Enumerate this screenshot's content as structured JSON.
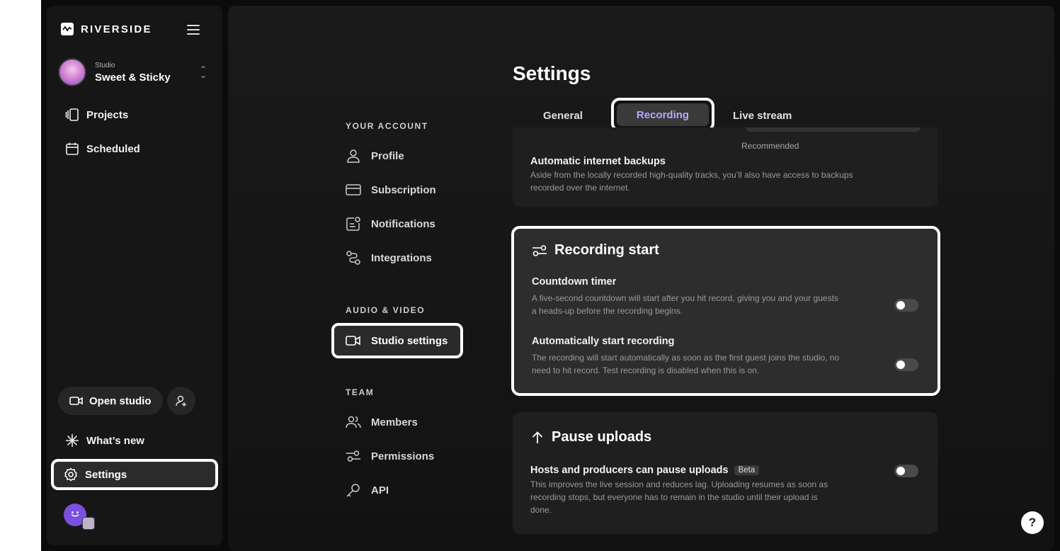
{
  "brand": {
    "name": "RIVERSIDE"
  },
  "studio": {
    "small_label": "Studio",
    "name": "Sweet & Sticky"
  },
  "sidebar": {
    "projects_label": "Projects",
    "scheduled_label": "Scheduled",
    "open_studio_label": "Open studio",
    "whats_new_label": "What’s new",
    "settings_label": "Settings"
  },
  "settings": {
    "title": "Settings",
    "sections": {
      "your_account": "YOUR ACCOUNT",
      "audio_video": "AUDIO & VIDEO",
      "team": "TEAM"
    },
    "account_items": [
      "Profile",
      "Subscription",
      "Notifications",
      "Integrations"
    ],
    "audio_video_items": [
      "Studio settings"
    ],
    "team_items": [
      "Members",
      "Permissions",
      "API"
    ]
  },
  "tabs": {
    "general": "General",
    "recording": "Recording",
    "live_stream": "Live stream"
  },
  "backups_card": {
    "recommended": "Recommended",
    "title": "Automatic internet backups",
    "desc_line1": "Aside from the locally recorded high-quality tracks, you’ll also have access to backups",
    "desc_line2": "recorded over the internet."
  },
  "recording_start": {
    "heading": "Recording start",
    "countdown_title": "Countdown timer",
    "countdown_desc1": "A five-second countdown will start after you hit record, giving you and your guests",
    "countdown_desc2": "a heads-up before the recording begins.",
    "countdown_enabled": false,
    "auto_title": "Automatically start recording",
    "auto_desc1": "The recording will start automatically as soon as the first guest joins the studio, no",
    "auto_desc2": "need to hit record. Test recording is disabled when this is on.",
    "auto_enabled": false
  },
  "pause_uploads": {
    "heading": "Pause uploads",
    "row_title": "Hosts and producers can pause uploads",
    "badge": "Beta",
    "desc1": "This improves the live session and reduces lag. Uploading resumes as soon as",
    "desc2": "recording stops, but everyone has to remain in the studio until their upload is",
    "desc3": "done.",
    "enabled": false
  },
  "help": {
    "label": "?"
  }
}
